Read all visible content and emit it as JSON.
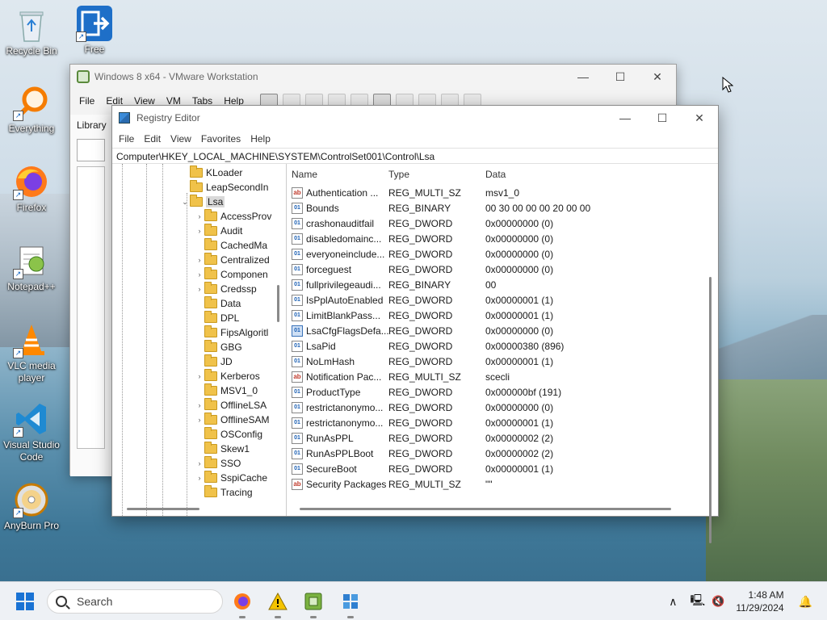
{
  "desktop": {
    "icons": [
      {
        "label": "Recycle Bin"
      },
      {
        "label": "Free"
      },
      {
        "label": "Everything"
      },
      {
        "label": "Firefox"
      },
      {
        "label": "Notepad++"
      },
      {
        "label": "VLC media player"
      },
      {
        "label": "Visual Studio Code"
      },
      {
        "label": "AnyBurn Pro"
      }
    ]
  },
  "vmware": {
    "title": "Windows 8 x64 - VMware Workstation",
    "menu": [
      "File",
      "Edit",
      "View",
      "VM",
      "Tabs",
      "Help"
    ],
    "library_label": "Library",
    "search_placeholder": "T"
  },
  "regedit": {
    "title": "Registry Editor",
    "menu": [
      "File",
      "Edit",
      "View",
      "Favorites",
      "Help"
    ],
    "address": "Computer\\HKEY_LOCAL_MACHINE\\SYSTEM\\ControlSet001\\Control\\Lsa",
    "tree": [
      {
        "label": "KLoader",
        "expand": false,
        "level": 1
      },
      {
        "label": "LeapSecondIn",
        "expand": false,
        "level": 1
      },
      {
        "label": "Lsa",
        "expand": true,
        "level": 1,
        "selected": true
      },
      {
        "label": "AccessProv",
        "expand": true,
        "level": 2
      },
      {
        "label": "Audit",
        "expand": true,
        "level": 2
      },
      {
        "label": "CachedMa",
        "expand": false,
        "level": 2
      },
      {
        "label": "Centralized",
        "expand": true,
        "level": 2
      },
      {
        "label": "Componen",
        "expand": true,
        "level": 2
      },
      {
        "label": "Credssp",
        "expand": true,
        "level": 2
      },
      {
        "label": "Data",
        "expand": false,
        "level": 2
      },
      {
        "label": "DPL",
        "expand": false,
        "level": 2
      },
      {
        "label": "FipsAlgoritl",
        "expand": false,
        "level": 2
      },
      {
        "label": "GBG",
        "expand": false,
        "level": 2
      },
      {
        "label": "JD",
        "expand": false,
        "level": 2
      },
      {
        "label": "Kerberos",
        "expand": true,
        "level": 2
      },
      {
        "label": "MSV1_0",
        "expand": false,
        "level": 2
      },
      {
        "label": "OfflineLSA",
        "expand": true,
        "level": 2
      },
      {
        "label": "OfflineSAM",
        "expand": true,
        "level": 2
      },
      {
        "label": "OSConfig",
        "expand": false,
        "level": 2
      },
      {
        "label": "Skew1",
        "expand": false,
        "level": 2
      },
      {
        "label": "SSO",
        "expand": true,
        "level": 2
      },
      {
        "label": "SspiCache",
        "expand": true,
        "level": 2
      },
      {
        "label": "Tracing",
        "expand": false,
        "level": 2
      }
    ],
    "columns": {
      "name": "Name",
      "type": "Type",
      "data": "Data"
    },
    "values": [
      {
        "name": "Authentication ...",
        "type": "REG_MULTI_SZ",
        "data": "msv1_0",
        "icon": "ab"
      },
      {
        "name": "Bounds",
        "type": "REG_BINARY",
        "data": "00 30 00 00 00 20 00 00",
        "icon": "bin"
      },
      {
        "name": "crashonauditfail",
        "type": "REG_DWORD",
        "data": "0x00000000 (0)",
        "icon": "bin"
      },
      {
        "name": "disabledomainc...",
        "type": "REG_DWORD",
        "data": "0x00000000 (0)",
        "icon": "bin"
      },
      {
        "name": "everyoneinclude...",
        "type": "REG_DWORD",
        "data": "0x00000000 (0)",
        "icon": "bin"
      },
      {
        "name": "forceguest",
        "type": "REG_DWORD",
        "data": "0x00000000 (0)",
        "icon": "bin"
      },
      {
        "name": "fullprivilegeaudi...",
        "type": "REG_BINARY",
        "data": "00",
        "icon": "bin"
      },
      {
        "name": "IsPplAutoEnabled",
        "type": "REG_DWORD",
        "data": "0x00000001 (1)",
        "icon": "bin"
      },
      {
        "name": "LimitBlankPass...",
        "type": "REG_DWORD",
        "data": "0x00000001 (1)",
        "icon": "bin"
      },
      {
        "name": "LsaCfgFlagsDefa...",
        "type": "REG_DWORD",
        "data": "0x00000000 (0)",
        "icon": "bin-hl"
      },
      {
        "name": "LsaPid",
        "type": "REG_DWORD",
        "data": "0x00000380 (896)",
        "icon": "bin"
      },
      {
        "name": "NoLmHash",
        "type": "REG_DWORD",
        "data": "0x00000001 (1)",
        "icon": "bin"
      },
      {
        "name": "Notification Pac...",
        "type": "REG_MULTI_SZ",
        "data": "scecli",
        "icon": "ab"
      },
      {
        "name": "ProductType",
        "type": "REG_DWORD",
        "data": "0x000000bf (191)",
        "icon": "bin"
      },
      {
        "name": "restrictanonymo...",
        "type": "REG_DWORD",
        "data": "0x00000000 (0)",
        "icon": "bin"
      },
      {
        "name": "restrictanonymo...",
        "type": "REG_DWORD",
        "data": "0x00000001 (1)",
        "icon": "bin"
      },
      {
        "name": "RunAsPPL",
        "type": "REG_DWORD",
        "data": "0x00000002 (2)",
        "icon": "bin"
      },
      {
        "name": "RunAsPPLBoot",
        "type": "REG_DWORD",
        "data": "0x00000002 (2)",
        "icon": "bin"
      },
      {
        "name": "SecureBoot",
        "type": "REG_DWORD",
        "data": "0x00000001 (1)",
        "icon": "bin"
      },
      {
        "name": "Security Packages",
        "type": "REG_MULTI_SZ",
        "data": "\"\"",
        "icon": "ab"
      }
    ]
  },
  "taskbar": {
    "search_placeholder": "Search",
    "time": "1:48 AM",
    "date": "11/29/2024"
  }
}
